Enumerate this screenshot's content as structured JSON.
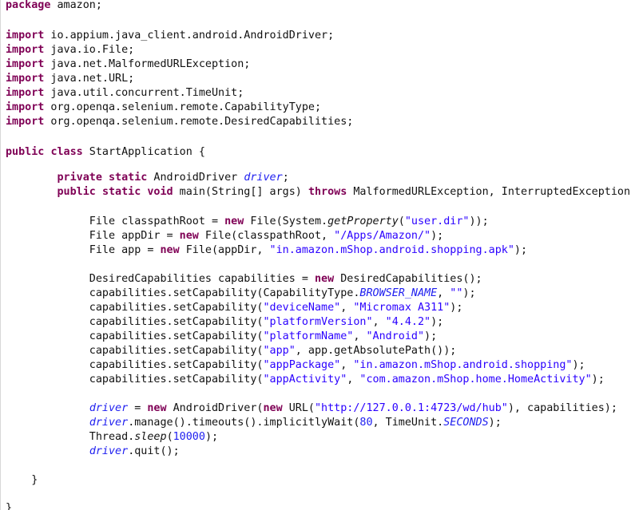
{
  "code_lines": [
    {
      "id": "l1",
      "tokens": [
        {
          "t": "package",
          "c": "kw"
        },
        {
          "t": " amazon;"
        }
      ]
    },
    {
      "id": "l2",
      "tokens": []
    },
    {
      "id": "l3",
      "tokens": [
        {
          "t": "import",
          "c": "kw"
        },
        {
          "t": " io.appium.java_client.android.AndroidDriver;"
        }
      ]
    },
    {
      "id": "l4",
      "tokens": [
        {
          "t": "import",
          "c": "kw"
        },
        {
          "t": " java.io.File;"
        }
      ]
    },
    {
      "id": "l5",
      "tokens": [
        {
          "t": "import",
          "c": "kw"
        },
        {
          "t": " java.net.MalformedURLException;"
        }
      ]
    },
    {
      "id": "l6",
      "tokens": [
        {
          "t": "import",
          "c": "kw"
        },
        {
          "t": " java.net.URL;"
        }
      ]
    },
    {
      "id": "l7",
      "tokens": [
        {
          "t": "import",
          "c": "kw"
        },
        {
          "t": " java.util.concurrent.TimeUnit;"
        }
      ]
    },
    {
      "id": "l8",
      "tokens": [
        {
          "t": "import",
          "c": "kw"
        },
        {
          "t": " org.openqa.selenium.remote.CapabilityType;"
        }
      ]
    },
    {
      "id": "l9",
      "tokens": [
        {
          "t": "import",
          "c": "kw"
        },
        {
          "t": " org.openqa.selenium.remote.DesiredCapabilities;"
        }
      ]
    },
    {
      "id": "l10",
      "tokens": []
    },
    {
      "id": "l11",
      "tokens": [
        {
          "t": "public",
          "c": "kw"
        },
        {
          "t": " "
        },
        {
          "t": "class",
          "c": "kw"
        },
        {
          "t": " StartApplication {"
        }
      ]
    },
    {
      "id": "l12",
      "tokens": []
    },
    {
      "id": "l13",
      "tokens": [
        {
          "t": "        "
        },
        {
          "t": "private",
          "c": "kw"
        },
        {
          "t": " "
        },
        {
          "t": "static",
          "c": "kw"
        },
        {
          "t": " AndroidDriver "
        },
        {
          "t": "driver",
          "c": "fld"
        },
        {
          "t": ";"
        }
      ]
    },
    {
      "id": "l14",
      "tokens": [
        {
          "t": "        "
        },
        {
          "t": "public",
          "c": "kw"
        },
        {
          "t": " "
        },
        {
          "t": "static",
          "c": "kw"
        },
        {
          "t": " "
        },
        {
          "t": "void",
          "c": "kw"
        },
        {
          "t": " main(String[] args) "
        },
        {
          "t": "throws",
          "c": "kw"
        },
        {
          "t": " MalformedURLException, InterruptedException"
        }
      ]
    },
    {
      "id": "l15",
      "tokens": []
    },
    {
      "id": "l16",
      "tokens": [
        {
          "t": "             File classpathRoot = "
        },
        {
          "t": "new",
          "c": "kw"
        },
        {
          "t": " File(System."
        },
        {
          "t": "getProperty",
          "c": "ital"
        },
        {
          "t": "("
        },
        {
          "t": "\"user.dir\"",
          "c": "str"
        },
        {
          "t": "));"
        }
      ]
    },
    {
      "id": "l17",
      "tokens": [
        {
          "t": "             File appDir = "
        },
        {
          "t": "new",
          "c": "kw"
        },
        {
          "t": " File(classpathRoot, "
        },
        {
          "t": "\"/Apps/Amazon/\"",
          "c": "str"
        },
        {
          "t": ");"
        }
      ]
    },
    {
      "id": "l18",
      "tokens": [
        {
          "t": "             File app = "
        },
        {
          "t": "new",
          "c": "kw"
        },
        {
          "t": " File(appDir, "
        },
        {
          "t": "\"in.amazon.mShop.android.shopping.apk\"",
          "c": "str"
        },
        {
          "t": ");"
        }
      ]
    },
    {
      "id": "l19",
      "tokens": []
    },
    {
      "id": "l20",
      "tokens": [
        {
          "t": "             DesiredCapabilities capabilities = "
        },
        {
          "t": "new",
          "c": "kw"
        },
        {
          "t": " DesiredCapabilities();"
        }
      ]
    },
    {
      "id": "l21",
      "tokens": [
        {
          "t": "             capabilities.setCapability(CapabilityType."
        },
        {
          "t": "BROWSER_NAME",
          "c": "fld"
        },
        {
          "t": ", "
        },
        {
          "t": "\"\"",
          "c": "str"
        },
        {
          "t": ");"
        }
      ]
    },
    {
      "id": "l22",
      "tokens": [
        {
          "t": "             capabilities.setCapability("
        },
        {
          "t": "\"deviceName\"",
          "c": "str"
        },
        {
          "t": ", "
        },
        {
          "t": "\"Micromax A311\"",
          "c": "str"
        },
        {
          "t": ");"
        }
      ]
    },
    {
      "id": "l23",
      "tokens": [
        {
          "t": "             capabilities.setCapability("
        },
        {
          "t": "\"platformVersion\"",
          "c": "str"
        },
        {
          "t": ", "
        },
        {
          "t": "\"4.4.2\"",
          "c": "str"
        },
        {
          "t": ");"
        }
      ]
    },
    {
      "id": "l24",
      "tokens": [
        {
          "t": "             capabilities.setCapability("
        },
        {
          "t": "\"platformName\"",
          "c": "str"
        },
        {
          "t": ", "
        },
        {
          "t": "\"Android\"",
          "c": "str"
        },
        {
          "t": ");"
        }
      ]
    },
    {
      "id": "l25",
      "tokens": [
        {
          "t": "             capabilities.setCapability("
        },
        {
          "t": "\"app\"",
          "c": "str"
        },
        {
          "t": ", app.getAbsolutePath());"
        }
      ]
    },
    {
      "id": "l26",
      "tokens": [
        {
          "t": "             capabilities.setCapability("
        },
        {
          "t": "\"appPackage\"",
          "c": "str"
        },
        {
          "t": ", "
        },
        {
          "t": "\"in.amazon.mShop.android.shopping\"",
          "c": "str"
        },
        {
          "t": ");"
        }
      ]
    },
    {
      "id": "l27",
      "tokens": [
        {
          "t": "             capabilities.setCapability("
        },
        {
          "t": "\"appActivity\"",
          "c": "str"
        },
        {
          "t": ", "
        },
        {
          "t": "\"com.amazon.mShop.home.HomeActivity\"",
          "c": "str"
        },
        {
          "t": ");"
        }
      ]
    },
    {
      "id": "l28",
      "tokens": []
    },
    {
      "id": "l29",
      "tokens": [
        {
          "t": "             "
        },
        {
          "t": "driver",
          "c": "fld"
        },
        {
          "t": " = "
        },
        {
          "t": "new",
          "c": "kw"
        },
        {
          "t": " AndroidDriver("
        },
        {
          "t": "new",
          "c": "kw"
        },
        {
          "t": " URL("
        },
        {
          "t": "\"http://127.0.0.1:4723/wd/hub\"",
          "c": "str"
        },
        {
          "t": "), capabilities);"
        }
      ]
    },
    {
      "id": "l30",
      "tokens": [
        {
          "t": "             "
        },
        {
          "t": "driver",
          "c": "fld"
        },
        {
          "t": ".manage().timeouts().implicitlyWait("
        },
        {
          "t": "80",
          "c": "num"
        },
        {
          "t": ", TimeUnit."
        },
        {
          "t": "SECONDS",
          "c": "fld"
        },
        {
          "t": ");"
        }
      ]
    },
    {
      "id": "l31",
      "tokens": [
        {
          "t": "             Thread."
        },
        {
          "t": "sleep",
          "c": "ital"
        },
        {
          "t": "("
        },
        {
          "t": "10000",
          "c": "num"
        },
        {
          "t": ");"
        }
      ]
    },
    {
      "id": "l32",
      "tokens": [
        {
          "t": "             "
        },
        {
          "t": "driver",
          "c": "fld"
        },
        {
          "t": ".quit();"
        }
      ]
    },
    {
      "id": "l33",
      "tokens": []
    },
    {
      "id": "l34",
      "tokens": [
        {
          "t": "    }"
        }
      ]
    },
    {
      "id": "l35",
      "tokens": []
    },
    {
      "id": "l36",
      "tokens": [
        {
          "t": "}"
        }
      ]
    }
  ],
  "colors": {
    "keyword": "#7f0055",
    "string": "#2a00ff",
    "number": "#1e1ef0",
    "field": "#1e1ef0",
    "text": "#111111",
    "background": "#ffffff"
  }
}
